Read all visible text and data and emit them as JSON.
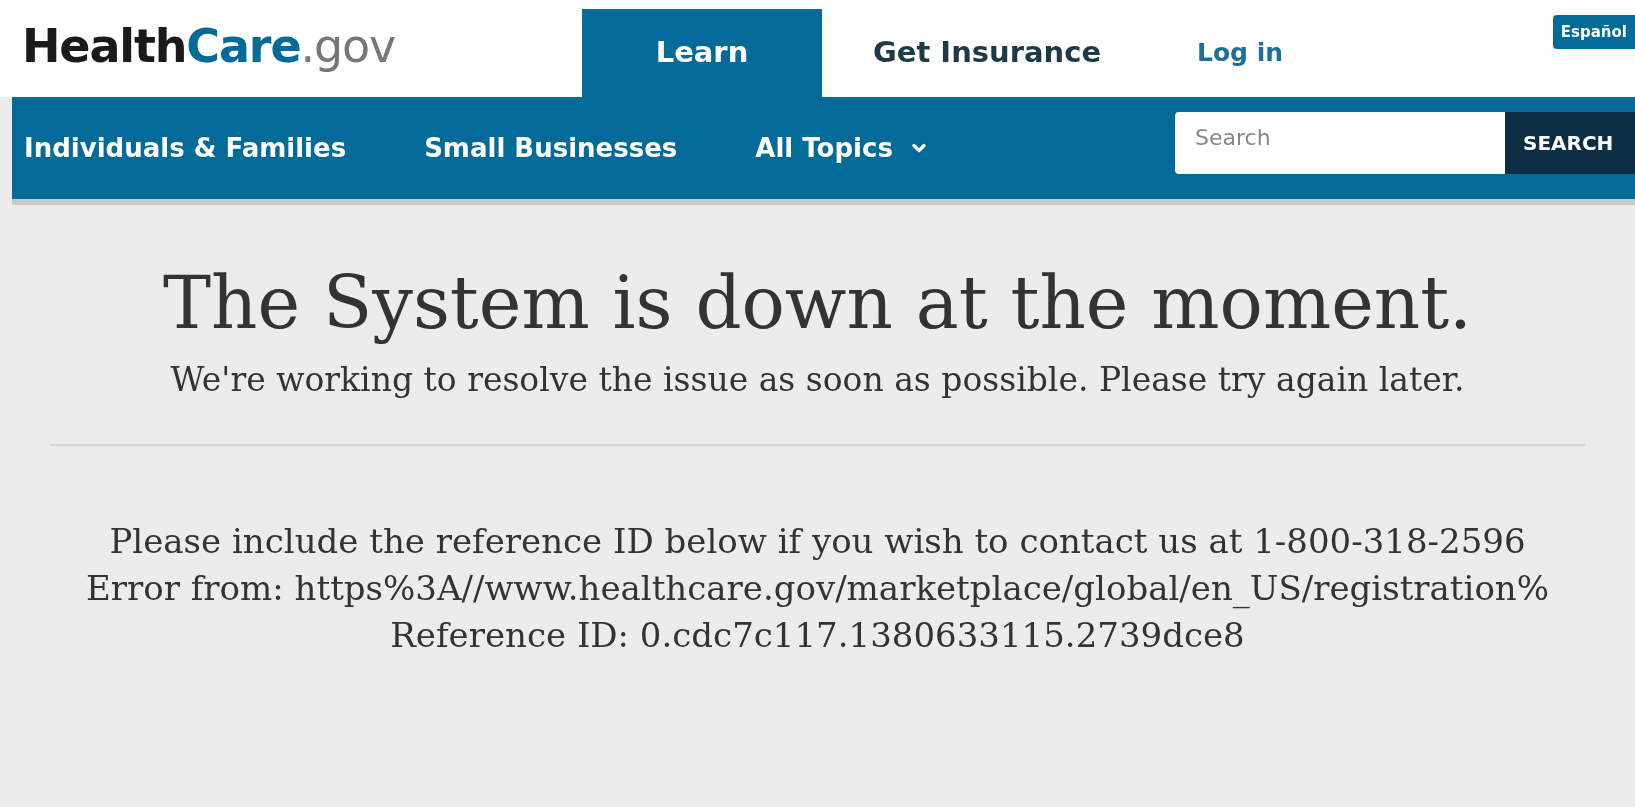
{
  "header": {
    "logo": [
      "Health",
      "Care",
      ".gov"
    ],
    "tabs": [
      {
        "label": "Learn",
        "selected": true
      },
      {
        "label": "Get Insurance",
        "selected": false
      }
    ],
    "login": "Log in",
    "language": "Español"
  },
  "nav": {
    "items": [
      {
        "label": "Individuals & Families",
        "dropdown": false
      },
      {
        "label": "Small Businesses",
        "dropdown": false
      },
      {
        "label": "All Topics",
        "dropdown": true
      }
    ],
    "search": {
      "placeholder": "Search",
      "button": "SEARCH"
    }
  },
  "message": {
    "title": "The System is down at the moment.",
    "subtitle": "We're working to resolve the issue as soon as possible. Please try again later.",
    "lines": [
      "Please include the reference ID below if you wish to contact us at 1-800-318-2596",
      "Error from: https%3A//www.healthcare.gov/marketplace/global/en_US/registration%",
      "Reference ID: 0.cdc7c117.1380633115.2739dce8"
    ]
  }
}
